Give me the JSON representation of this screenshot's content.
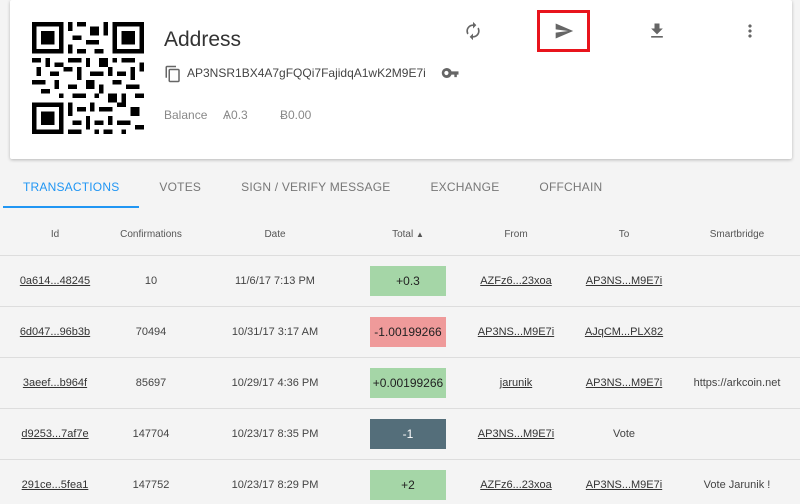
{
  "account": {
    "title": "Address",
    "address": "AP3NSR1BX4A7gFQQi7FajidqA1wK2M9E7i",
    "balance_label": "Balance",
    "balance_ark": "Ѧ0.3",
    "balance_usd": "Ƀ0.00"
  },
  "actions": [
    {
      "name": "refresh-icon"
    },
    {
      "name": "send-icon"
    },
    {
      "name": "download-icon"
    },
    {
      "name": "more-vert-icon"
    }
  ],
  "tabs": [
    {
      "label": "TRANSACTIONS",
      "active": true
    },
    {
      "label": "VOTES"
    },
    {
      "label": "SIGN / VERIFY MESSAGE"
    },
    {
      "label": "EXCHANGE"
    },
    {
      "label": "OFFCHAIN"
    }
  ],
  "table": {
    "headers": {
      "id": "Id",
      "confirmations": "Confirmations",
      "date": "Date",
      "total": "Total",
      "sort_arrow": "▲",
      "from": "From",
      "to": "To",
      "smartbridge": "Smartbridge"
    },
    "rows": [
      {
        "id": "0a614...48245",
        "confirmations": "10",
        "date": "11/6/17 7:13 PM",
        "total": "+0.3",
        "total_type": "pos",
        "from": "AZFz6...23xoa",
        "to": "AP3NS...M9E7i",
        "to_link": true,
        "smartbridge": ""
      },
      {
        "id": "6d047...96b3b",
        "confirmations": "70494",
        "date": "10/31/17 3:17 AM",
        "total": "-1.00199266",
        "total_type": "neg",
        "from": "AP3NS...M9E7i",
        "to": "AJqCM...PLX82",
        "to_link": true,
        "smartbridge": ""
      },
      {
        "id": "3aeef...b964f",
        "confirmations": "85697",
        "date": "10/29/17 4:36 PM",
        "total": "+0.00199266",
        "total_type": "pos",
        "from": "jarunik",
        "to": "AP3NS...M9E7i",
        "to_link": true,
        "smartbridge": "https://arkcoin.net"
      },
      {
        "id": "d9253...7af7e",
        "confirmations": "147704",
        "date": "10/23/17 8:35 PM",
        "total": "-1",
        "total_type": "vote",
        "from": "AP3NS...M9E7i",
        "to": "Vote",
        "to_link": false,
        "smartbridge": ""
      },
      {
        "id": "291ce...5fea1",
        "confirmations": "147752",
        "date": "10/23/17 8:29 PM",
        "total": "+2",
        "total_type": "pos",
        "from": "AZFz6...23xoa",
        "to": "AP3NS...M9E7i",
        "to_link": true,
        "smartbridge": "Vote Jarunik !"
      }
    ]
  },
  "colors": {
    "accent": "#2196f3",
    "positive": "#a5d6a7",
    "negative": "#ef9a9a",
    "vote": "#546e7a",
    "highlight": "#e8141c"
  }
}
